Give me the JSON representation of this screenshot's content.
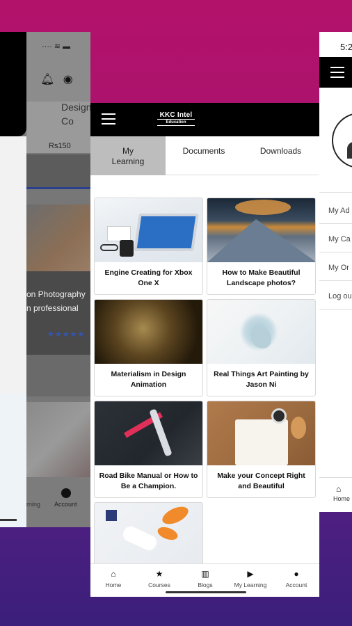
{
  "left_screen": {
    "course_text": "Design Co",
    "price": "Rs150",
    "card_title_line1": "on Photography",
    "card_title_line2": "n professional",
    "stars": "★★★★★",
    "nav_left_label": "rning",
    "nav_account_label": "Account"
  },
  "right_screen": {
    "time": "5:2",
    "menu_items": [
      "My Ad",
      "My Ca",
      "My Or",
      "Log ou"
    ],
    "nav_home_label": "Home"
  },
  "app": {
    "logo_title": "KKC Intel",
    "logo_subtitle": "Education",
    "tabs": [
      {
        "label": "My Learning",
        "active": true
      },
      {
        "label": "Documents",
        "active": false
      },
      {
        "label": "Downloads",
        "active": false
      }
    ],
    "courses": [
      {
        "title": "Engine Creating for Xbox One X",
        "image": "xbox-laptop"
      },
      {
        "title": "How to Make Beautiful Landscape photos?",
        "image": "mountain-sunset"
      },
      {
        "title": "Materialism in Design Animation",
        "image": "dark-figure"
      },
      {
        "title": "Real Things Art Painting by Jason Ni",
        "image": "plant-art"
      },
      {
        "title": "Road Bike Manual or How to Be a Champion.",
        "image": "bike-desk"
      },
      {
        "title": "Make your Concept Right and Beautiful",
        "image": "notebook-desk"
      },
      {
        "title": "",
        "image": "shoes-desk"
      }
    ],
    "bottom_nav": [
      {
        "label": "Home",
        "icon": "home-icon",
        "glyph": "⌂"
      },
      {
        "label": "Courses",
        "icon": "star-icon",
        "glyph": "★"
      },
      {
        "label": "Blogs",
        "icon": "map-icon",
        "glyph": "▥"
      },
      {
        "label": "My Learning",
        "icon": "play-icon",
        "glyph": "▶"
      },
      {
        "label": "Account",
        "icon": "account-icon",
        "glyph": "●"
      }
    ]
  },
  "colors": {
    "bg_top": "#b3126a",
    "bg_bottom": "#3b1f7a",
    "header": "#000000",
    "active_tab": "#bdbdbd"
  }
}
